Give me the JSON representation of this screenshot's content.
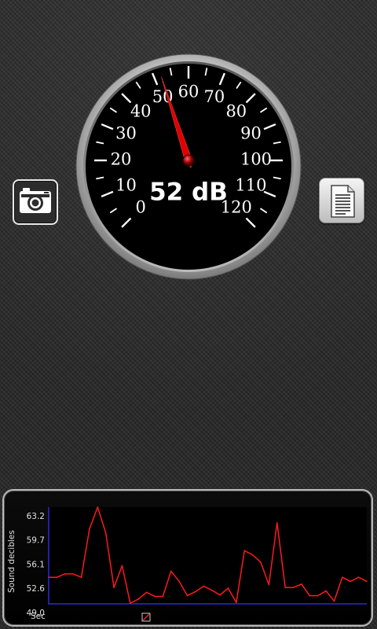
{
  "meter": {
    "value": 52,
    "unit": "dB",
    "reading_text": "52 dB",
    "scale_labels": [
      "0",
      "10",
      "20",
      "30",
      "40",
      "50",
      "60",
      "70",
      "80",
      "90",
      "100",
      "110",
      "120"
    ],
    "scale_min": 0,
    "scale_max": 120
  },
  "buttons": {
    "camera_icon": "camera-icon",
    "log_icon": "document-icon"
  },
  "chart_data": {
    "type": "line",
    "ylabel": "Sound decibles",
    "xlabel": "Sec",
    "ylim": [
      49.0,
      63.2
    ],
    "yticks": [
      "63.2",
      "59.7",
      "56.1",
      "52.6",
      "49.0"
    ],
    "series": [
      {
        "color": "#ff1a1a",
        "values": [
          52.9,
          52.9,
          53.4,
          53.4,
          52.9,
          60.0,
          64.4,
          59.4,
          51.4,
          54.6,
          49.1,
          49.7,
          50.7,
          50.1,
          50.1,
          53.8,
          52.3,
          50.2,
          50.8,
          51.6,
          51.0,
          50.3,
          51.3,
          49.2,
          56.8,
          56.2,
          55.1,
          51.8,
          60.9,
          51.4,
          51.4,
          51.9,
          50.2,
          50.2,
          50.9,
          49.4,
          52.9,
          52.3,
          52.9,
          52.3
        ]
      }
    ],
    "grid": false,
    "legend": "none"
  }
}
